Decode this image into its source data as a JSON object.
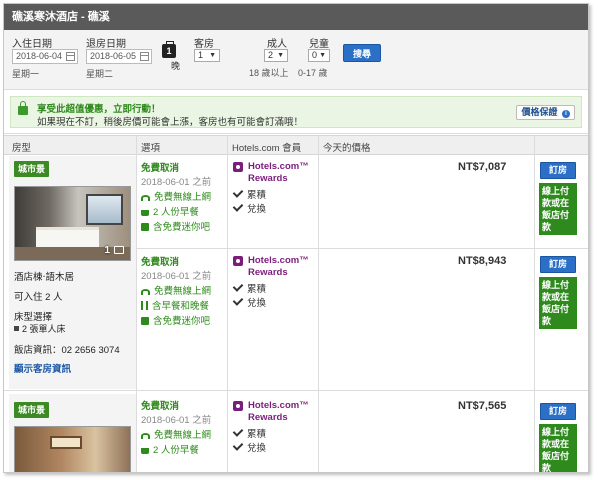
{
  "title": "礁溪寒沐酒店 - 礁溪",
  "search": {
    "checkin_label": "入住日期",
    "checkin_value": "2018-06-04",
    "checkin_weekday": "星期一",
    "checkout_label": "退房日期",
    "checkout_value": "2018-06-05",
    "checkout_weekday": "星期二",
    "nights_value": "1",
    "nights_unit": "晚",
    "rooms_label": "客房",
    "rooms_value": "1",
    "adults_label": "成人",
    "adults_value": "2",
    "adults_age": "18 歲以上",
    "children_label": "兒童",
    "children_value": "0",
    "children_age": "0-17 歲",
    "search_button": "搜尋"
  },
  "promo": {
    "title": "享受此超值優惠，立即行動！",
    "text": "如果現在不訂，稍後房價可能會上漲，客房也有可能會訂滿哦！",
    "guarantee_label": "價格保證",
    "guarantee_icon": "i"
  },
  "table": {
    "headers": [
      "房型",
      "選項",
      "Hotels.com 會員",
      "今天的價格"
    ]
  },
  "rows": [
    {
      "badge": "城市景",
      "photo_count": "1",
      "option_title": "免費取消",
      "option_date": "2018-06-01 之前",
      "amenities": [
        "免費無線上網",
        "2 人份早餐",
        "含免費迷你吧"
      ],
      "rewards_title_1": "Hotels.com™",
      "rewards_title_2": "Rewards",
      "rewards_items": [
        "累積",
        "兌換"
      ],
      "price": "NT$7,087",
      "book_label": "訂房",
      "pay_label": "線上付款或在飯店付款"
    },
    {
      "room_name": "酒店棟‧語木居",
      "capacity": "可入住 2 人",
      "bed_label": "床型選擇",
      "bed_value": "2 張單人床",
      "phone": "飯店資訊：02 2656 3074",
      "details_link": "顯示客房資訊",
      "option_title": "免費取消",
      "option_date": "2018-06-01 之前",
      "amenities": [
        "免費無線上網",
        "含早餐和晚餐",
        "含免費迷你吧"
      ],
      "rewards_title_1": "Hotels.com™",
      "rewards_title_2": "Rewards",
      "rewards_items": [
        "累積",
        "兌換"
      ],
      "price": "NT$8,943",
      "book_label": "訂房",
      "pay_label": "線上付款或在飯店付款"
    },
    {
      "badge": "城市景",
      "option_title": "免費取消",
      "option_date": "2018-06-01 之前",
      "amenities": [
        "免費無線上網",
        "2 人份早餐"
      ],
      "rewards_title_1": "Hotels.com™",
      "rewards_title_2": "Rewards",
      "rewards_items": [
        "累積",
        "兌換"
      ],
      "price": "NT$7,565",
      "book_label": "訂房",
      "pay_label": "線上付款或在飯店付款"
    }
  ],
  "colors": {
    "title_bar": "#5a5a5a",
    "accent_green": "#2f8a1d",
    "badge_green": "#3c8a23",
    "button_blue": "#2b6fc6",
    "rewards_purple": "#7b1e7b"
  }
}
